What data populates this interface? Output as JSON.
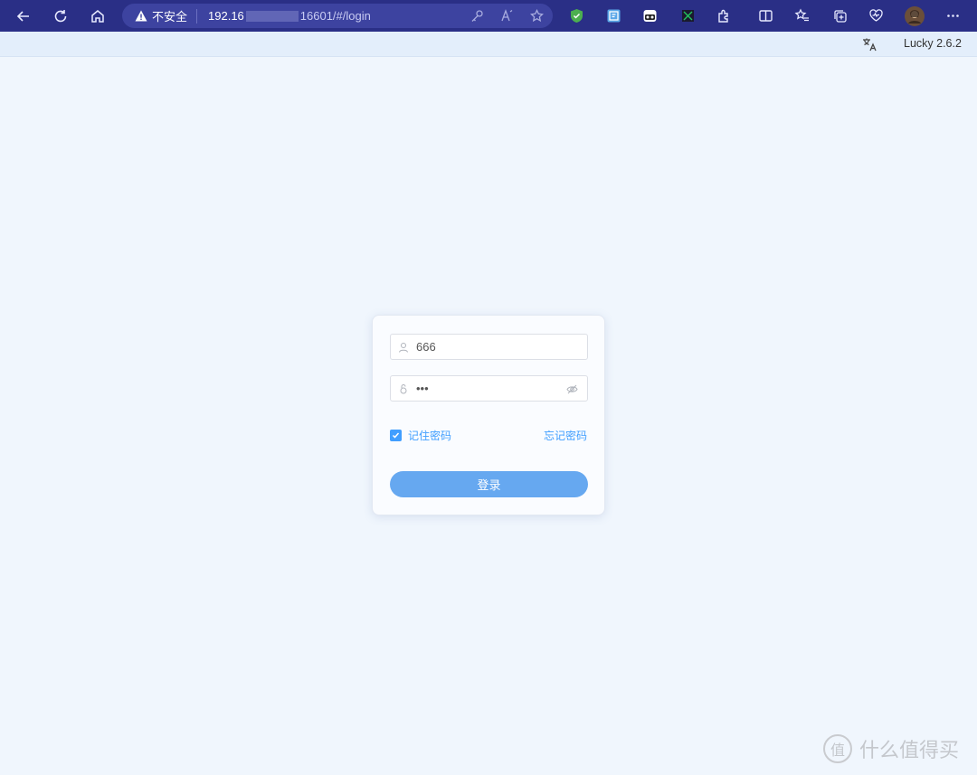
{
  "browser": {
    "security_label": "不安全",
    "url_host_start": "192.16",
    "url_rest": "16601/#/login"
  },
  "app": {
    "version": "Lucky 2.6.2"
  },
  "login": {
    "username_value": "666",
    "password_value": "•••",
    "remember_label": "记住密码",
    "remember_checked": true,
    "forgot_label": "忘记密码",
    "submit_label": "登录"
  },
  "watermark": {
    "badge": "值",
    "text": "什么值得买"
  },
  "colors": {
    "toolbar_bg": "#2a2f86",
    "page_bg": "#f0f6fd",
    "accent": "#409eff",
    "button_bg": "#66a8f0"
  }
}
